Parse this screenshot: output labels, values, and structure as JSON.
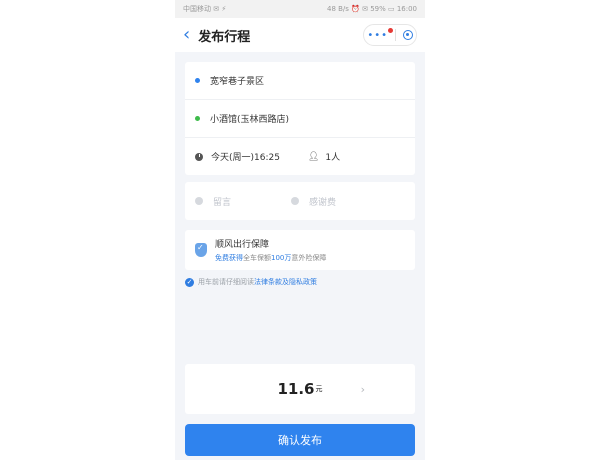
{
  "status_bar": {
    "carrier": "中国移动 ✉ ⚡",
    "right": "48 B/s ⏰ ✉ 59% ▭ 16:00"
  },
  "header": {
    "title": "发布行程",
    "back_icon": "chevron-left-icon",
    "menu_icon": "more-dots-icon",
    "target_icon": "target-icon"
  },
  "route": {
    "start": "宽窄巷子景区",
    "end": "小酒馆(玉林西路店)",
    "time": "今天(周一)16:25",
    "passengers": "1人",
    "start_color": "#2f83ee",
    "end_color": "#3dbb4a"
  },
  "extras": {
    "message_placeholder": "留言",
    "thanks_placeholder": "感谢费"
  },
  "guarantee": {
    "title": "顺风出行保障",
    "sub_prefix": "免费获得",
    "sub_mid1": "全车保额",
    "sub_amount": "100万",
    "sub_suffix": "意外险保障"
  },
  "agreement": {
    "prefix": "用车前请仔细阅读",
    "link": "法律条款及隐私政策"
  },
  "price": {
    "value": "11.6",
    "unit": "元"
  },
  "confirm_label": "确认发布",
  "colors": {
    "accent": "#2f83ee"
  }
}
